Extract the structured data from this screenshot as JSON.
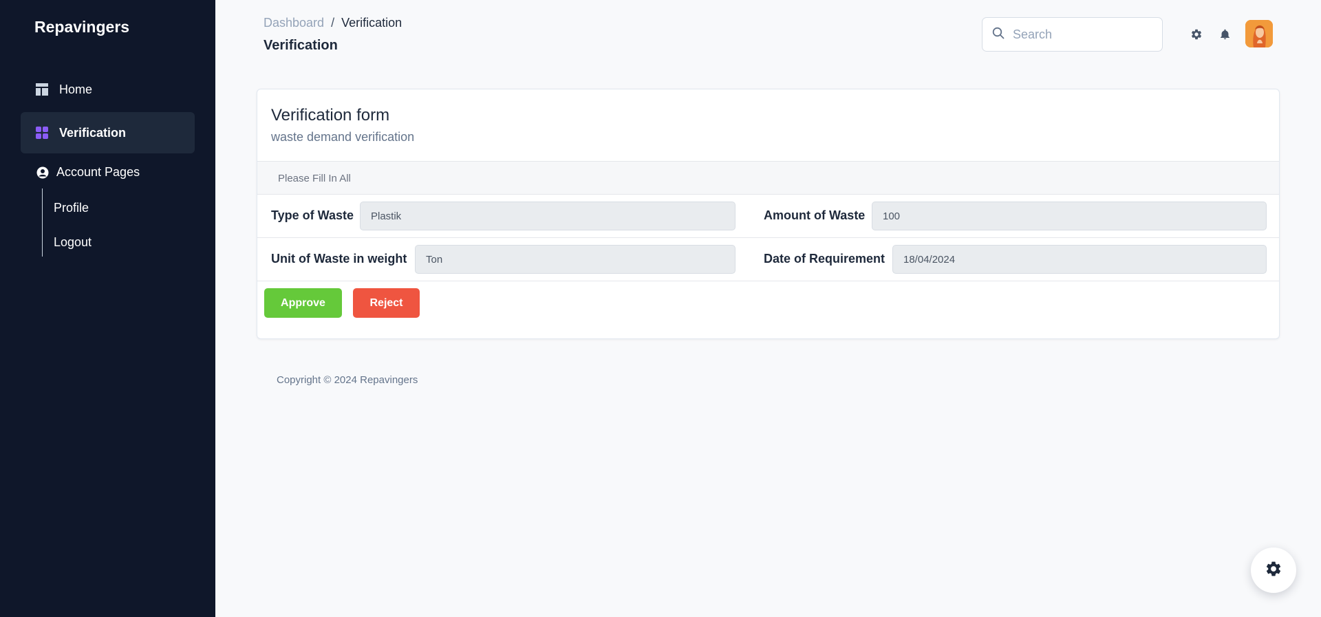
{
  "brand": "Repavingers",
  "sidebar": {
    "items": [
      {
        "label": "Home",
        "icon": "dashboard-icon"
      },
      {
        "label": "Verification",
        "icon": "grid-icon",
        "active": true
      }
    ],
    "account": {
      "label": "Account Pages",
      "icon": "user-circle-icon"
    },
    "subitems": [
      {
        "label": "Profile"
      },
      {
        "label": "Logout"
      }
    ]
  },
  "header": {
    "breadcrumb": {
      "root": "Dashboard",
      "separator": "/",
      "current": "Verification"
    },
    "title": "Verification",
    "search_placeholder": "Search"
  },
  "card": {
    "title": "Verification form",
    "subtitle": "waste demand verification",
    "notice": "Please Fill In All",
    "fields": {
      "type_label": "Type of Waste",
      "type_value": "Plastik",
      "amount_label": "Amount of Waste",
      "amount_value": "100",
      "unit_label": "Unit of Waste in weight",
      "unit_value": "Ton",
      "date_label": "Date of Requirement",
      "date_value": "18/04/2024"
    },
    "approve_label": "Approve",
    "reject_label": "Reject"
  },
  "footer": "Copyright © 2024 Repavingers",
  "colors": {
    "sidebar_bg": "#0f172a",
    "active_bg": "#1e293b",
    "accent_purple": "#8b5cf6",
    "approve": "#65c93a",
    "reject": "#ef5540"
  }
}
